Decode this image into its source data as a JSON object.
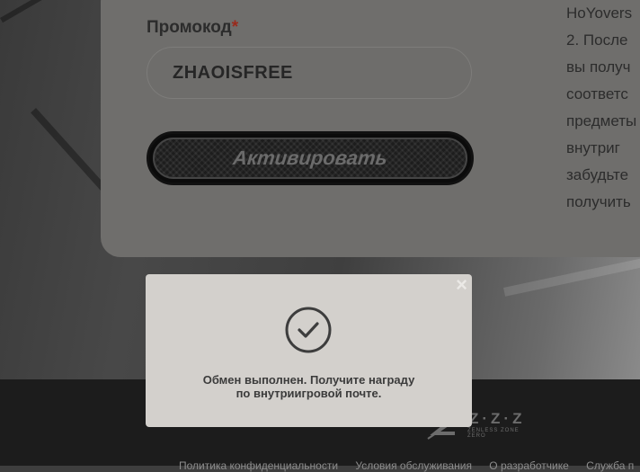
{
  "form": {
    "promo_label": "Промокод",
    "required_mark": "*",
    "promo_value": "ZHAOISFREE",
    "activate_label": "Активировать"
  },
  "info_text": {
    "lines": [
      "HoYovers",
      "2. После",
      "вы получ",
      "соответс",
      "предметы",
      "внутриг",
      "забудьте",
      "получить"
    ]
  },
  "toast": {
    "close_symbol": "×",
    "icon": "check-circle-icon",
    "line1": "Обмен выполнен. Получите награду",
    "line2": "по внутриигровой почте."
  },
  "footer": {
    "logo_marks": "Z·Z·Z",
    "logo_sub": "ZENLESS ZONE ZERO",
    "links": [
      "Политика конфиденциальности",
      "Условия обслуживания",
      "О разработчике",
      "Служба п"
    ]
  },
  "colors": {
    "card": "#6f6e6c",
    "toast": "#d3d0cc",
    "footer": "#1c1c1c",
    "required": "#9a2a1c"
  }
}
